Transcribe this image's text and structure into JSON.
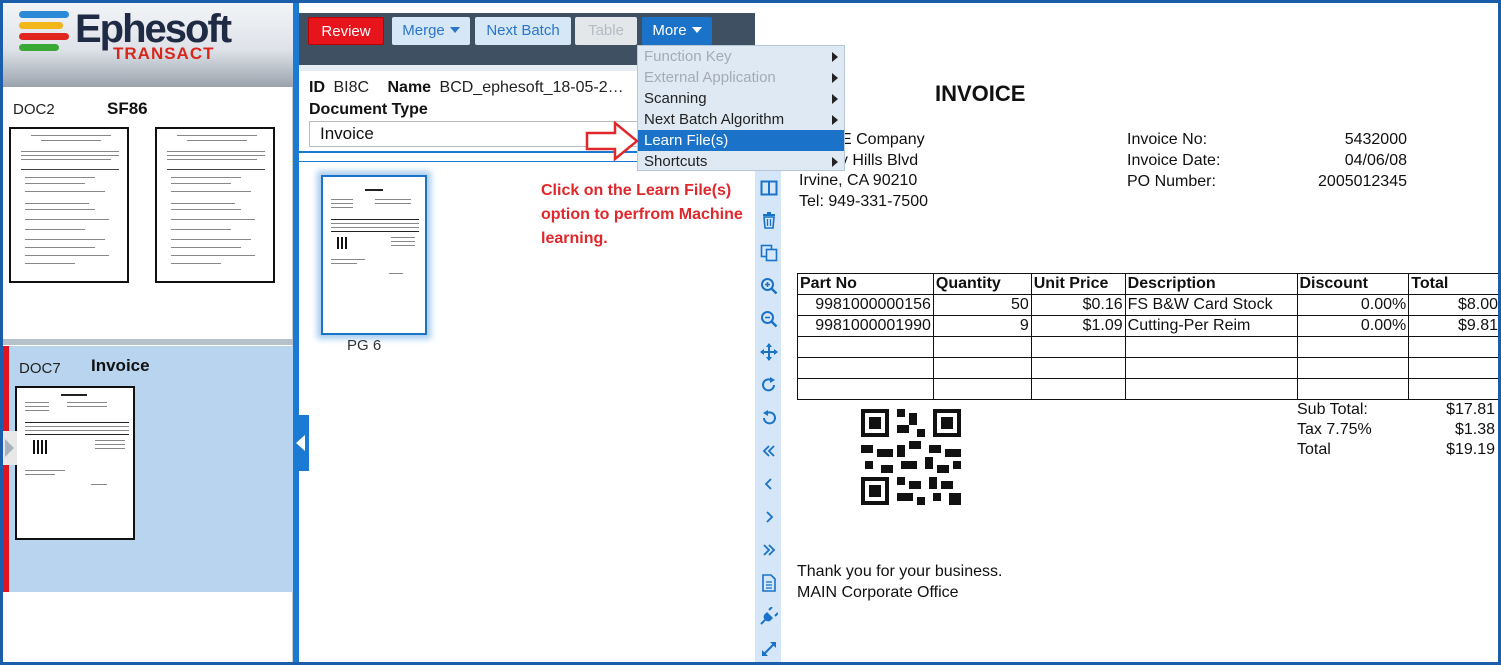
{
  "app": {
    "logo_text": "Ephesoft",
    "logo_sub": "TRANSACT",
    "colors": {
      "accent": "#1a73c8",
      "review": "#e8141c",
      "callout": "#e0272b",
      "frame": "#1a5eab"
    }
  },
  "documents": [
    {
      "id": "DOC2",
      "type": "SF86"
    },
    {
      "id": "DOC7",
      "type": "Invoice"
    }
  ],
  "toolbar": {
    "review_label": "Review",
    "merge_label": "Merge",
    "next_batch_label": "Next Batch",
    "table_label": "Table",
    "more_label": "More"
  },
  "batch": {
    "id_label": "ID",
    "id_value": "BI8C",
    "name_label": "Name",
    "name_value": "BCD_ephesoft_18-05-2…",
    "doctype_label": "Document Type",
    "doctype_value": "Invoice"
  },
  "pages": [
    {
      "label": "PG 6"
    }
  ],
  "callout_text": "Click on the Learn File(s) option to perfrom Machine learning.",
  "more_menu": {
    "items": [
      {
        "label": "Function Key",
        "disabled": true,
        "submenu": true
      },
      {
        "label": "External Application",
        "disabled": true,
        "submenu": true
      },
      {
        "label": "Scanning",
        "disabled": false,
        "submenu": true
      },
      {
        "label": "Next Batch Algorithm",
        "disabled": false,
        "submenu": true
      },
      {
        "label": "Learn File(s)",
        "disabled": false,
        "submenu": false,
        "active": true
      },
      {
        "label": "Shortcuts",
        "disabled": false,
        "submenu": true
      }
    ]
  },
  "tools": [
    "split-icon",
    "trash-icon",
    "copy-icon",
    "zoom-in-icon",
    "zoom-out-icon",
    "move-icon",
    "rotate-right-icon",
    "rotate-left-icon",
    "first-page-icon",
    "prev-page-icon",
    "next-page-icon",
    "last-page-icon",
    "document-icon",
    "plugin-icon",
    "expand-icon"
  ],
  "invoice": {
    "title": "INVOICE",
    "company": "E Company",
    "street": "rly Hills Blvd",
    "city": "Irvine, CA 90210",
    "tel": "Tel: 949-331-7500",
    "meta": [
      {
        "label": "Invoice No:",
        "value": "5432000"
      },
      {
        "label": "Invoice Date:",
        "value": "04/06/08"
      },
      {
        "label": "PO Number:",
        "value": "2005012345"
      }
    ],
    "columns": [
      "Part No",
      "Quantity",
      "Unit Price",
      "Description",
      "Discount",
      "Total"
    ],
    "rows": [
      [
        "9981000000156",
        "50",
        "$0.16",
        "FS B&W Card Stock",
        "0.00%",
        "$8.00"
      ],
      [
        "9981000001990",
        "9",
        "$1.09",
        "Cutting-Per Reim",
        "0.00%",
        "$9.81"
      ],
      [
        "",
        "",
        "",
        "",
        "",
        ""
      ],
      [
        "",
        "",
        "",
        "",
        "",
        ""
      ],
      [
        "",
        "",
        "",
        "",
        "",
        ""
      ]
    ],
    "totals": [
      {
        "label": "Sub Total:",
        "value": "$17.81"
      },
      {
        "label": "Tax 7.75%",
        "value": "$1.38"
      },
      {
        "label": "Total",
        "value": "$19.19"
      }
    ],
    "thanks": "Thank you for your business.",
    "office": "MAIN Corporate Office"
  }
}
